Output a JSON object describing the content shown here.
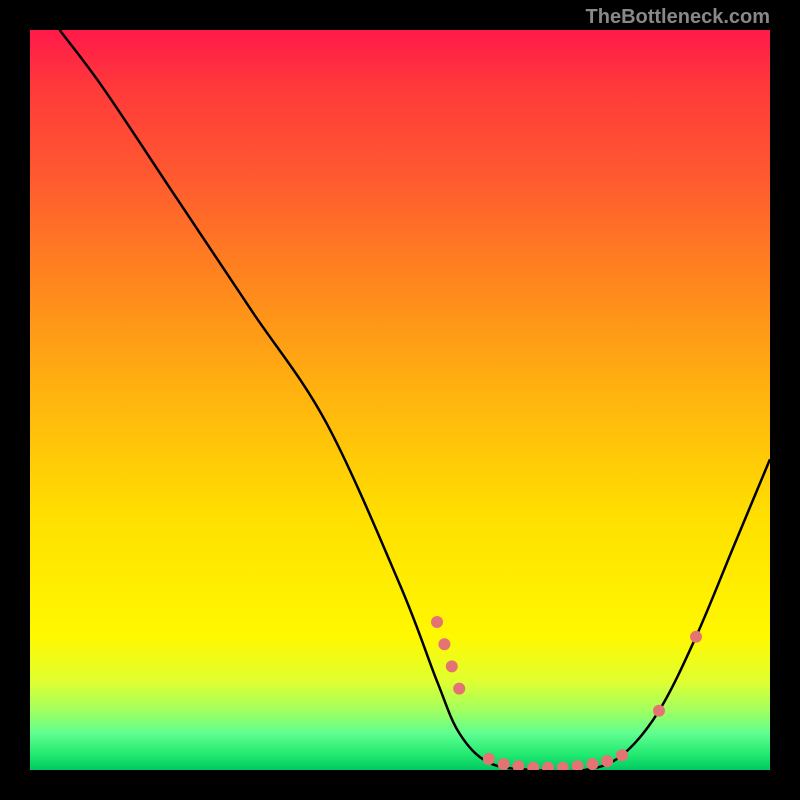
{
  "watermark": "TheBottleneck.com",
  "chart_data": {
    "type": "line",
    "title": "",
    "xlabel": "",
    "ylabel": "",
    "xlim": [
      0,
      100
    ],
    "ylim": [
      0,
      100
    ],
    "series": [
      {
        "name": "bottleneck-curve",
        "x": [
          4,
          10,
          20,
          30,
          40,
          50,
          55,
          58,
          62,
          68,
          75,
          80,
          85,
          90,
          95,
          100
        ],
        "y": [
          100,
          92,
          77,
          62,
          47,
          25,
          12,
          5,
          1,
          0,
          0,
          2,
          8,
          18,
          30,
          42
        ]
      }
    ],
    "dots": [
      {
        "x": 55,
        "y": 20
      },
      {
        "x": 56,
        "y": 17
      },
      {
        "x": 57,
        "y": 14
      },
      {
        "x": 58,
        "y": 11
      },
      {
        "x": 62,
        "y": 1.5
      },
      {
        "x": 64,
        "y": 0.8
      },
      {
        "x": 66,
        "y": 0.5
      },
      {
        "x": 68,
        "y": 0.3
      },
      {
        "x": 70,
        "y": 0.3
      },
      {
        "x": 72,
        "y": 0.3
      },
      {
        "x": 74,
        "y": 0.5
      },
      {
        "x": 76,
        "y": 0.8
      },
      {
        "x": 78,
        "y": 1.2
      },
      {
        "x": 80,
        "y": 2
      },
      {
        "x": 85,
        "y": 8
      },
      {
        "x": 90,
        "y": 18
      }
    ],
    "gradient_stops": [
      {
        "pos": 0,
        "color": "#ff1a4a"
      },
      {
        "pos": 66,
        "color": "#ffe000"
      },
      {
        "pos": 95,
        "color": "#60ff90"
      },
      {
        "pos": 100,
        "color": "#00c860"
      }
    ]
  }
}
